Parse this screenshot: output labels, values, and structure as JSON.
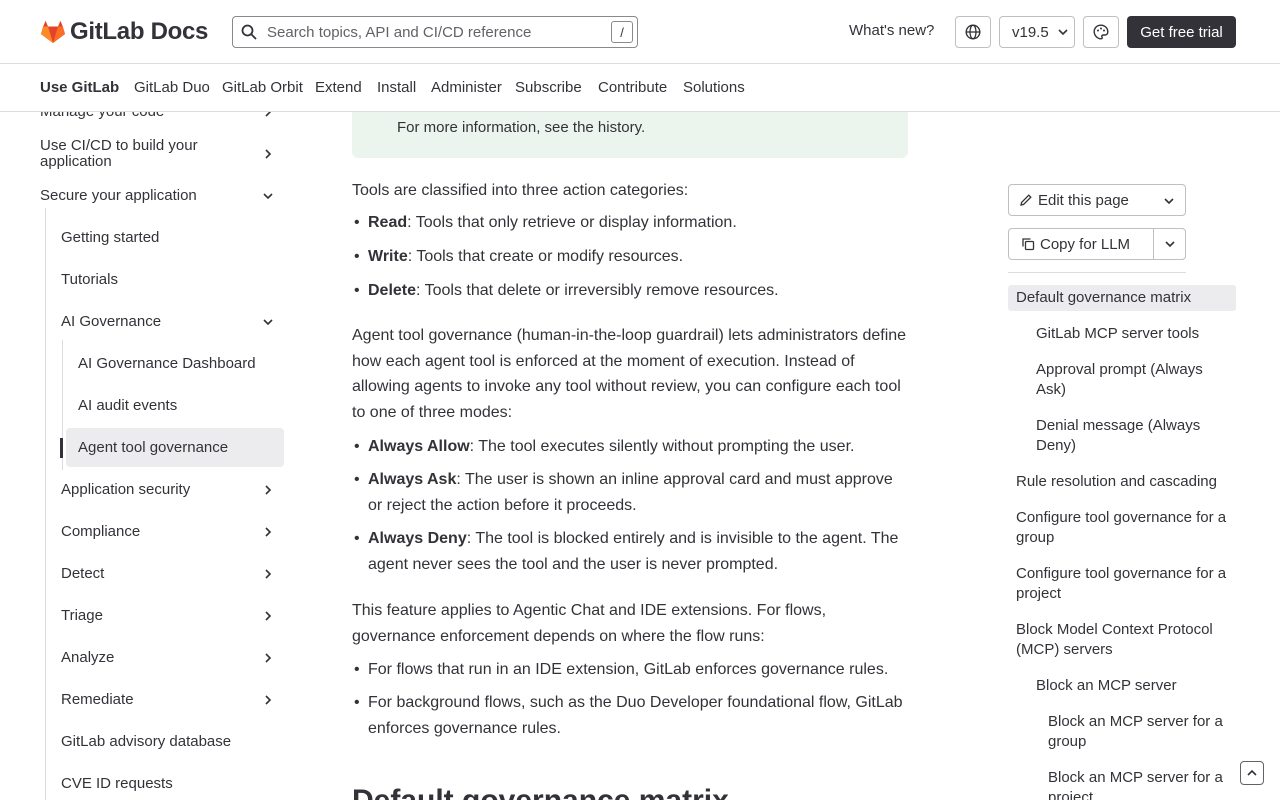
{
  "header": {
    "logo_text": "GitLab Docs",
    "search_placeholder": "Search topics, API and CI/CD reference",
    "search_shortcut": "/",
    "whats_new": "What's new?",
    "version": "v19.5",
    "trial_button": "Get free trial"
  },
  "nav": {
    "items": [
      "Use GitLab",
      "GitLab Duo",
      "GitLab Orbit",
      "Extend",
      "Install",
      "Administer",
      "Subscribe",
      "Contribute",
      "Solutions"
    ]
  },
  "sidebar": {
    "items": [
      "Manage your code",
      "Use CI/CD to build your application",
      "Secure your application",
      "Getting started",
      "Tutorials",
      "AI Governance",
      "AI Governance Dashboard",
      "AI audit events",
      "Agent tool governance",
      "Application security",
      "Compliance",
      "Detect",
      "Triage",
      "Analyze",
      "Remediate",
      "GitLab advisory database",
      "CVE ID requests"
    ]
  },
  "main": {
    "note_text": "For more information, see the history.",
    "intro": "Tools are classified into three action categories:",
    "categories": [
      {
        "term": "Read",
        "desc": ": Tools that only retrieve or display information."
      },
      {
        "term": "Write",
        "desc": ": Tools that create or modify resources."
      },
      {
        "term": "Delete",
        "desc": ": Tools that delete or irreversibly remove resources."
      }
    ],
    "para2": "Agent tool governance (human-in-the-loop guardrail) lets administrators define how each agent tool is enforced at the moment of execution. Instead of allowing agents to invoke any tool without review, you can configure each tool to one of three modes:",
    "modes": [
      {
        "term": "Always Allow",
        "desc": ": The tool executes silently without prompting the user."
      },
      {
        "term": "Always Ask",
        "desc": ": The user is shown an inline approval card and must approve or reject the action before it proceeds."
      },
      {
        "term": "Always Deny",
        "desc": ": The tool is blocked entirely and is invisible to the agent. The agent never sees the tool and the user is never prompted."
      }
    ],
    "para3": "This feature applies to Agentic Chat and IDE extensions. For flows, governance enforcement depends on where the flow runs:",
    "flows": [
      "For flows that run in an IDE extension, GitLab enforces governance rules.",
      "For background flows, such as the Duo Developer foundational flow, GitLab enforces governance rules."
    ],
    "heading": "Default governance matrix"
  },
  "right": {
    "edit_label": "Edit this page",
    "copy_label": "Copy for LLM",
    "toc": [
      "Default governance matrix",
      "GitLab MCP server tools",
      "Approval prompt (Always Ask)",
      "Denial message (Always Deny)",
      "Rule resolution and cascading",
      "Configure tool governance for a group",
      "Configure tool governance for a project",
      "Block Model Context Protocol (MCP) servers",
      "Block an MCP server",
      "Block an MCP server for a group",
      "Block an MCP server for a project"
    ]
  },
  "colors": {
    "text": "#333238",
    "note_bg": "#ecf4ee",
    "active_bg": "#ececef",
    "logo_orange": "#fc6d26",
    "logo_red": "#e24329",
    "logo_amber": "#fca326"
  }
}
